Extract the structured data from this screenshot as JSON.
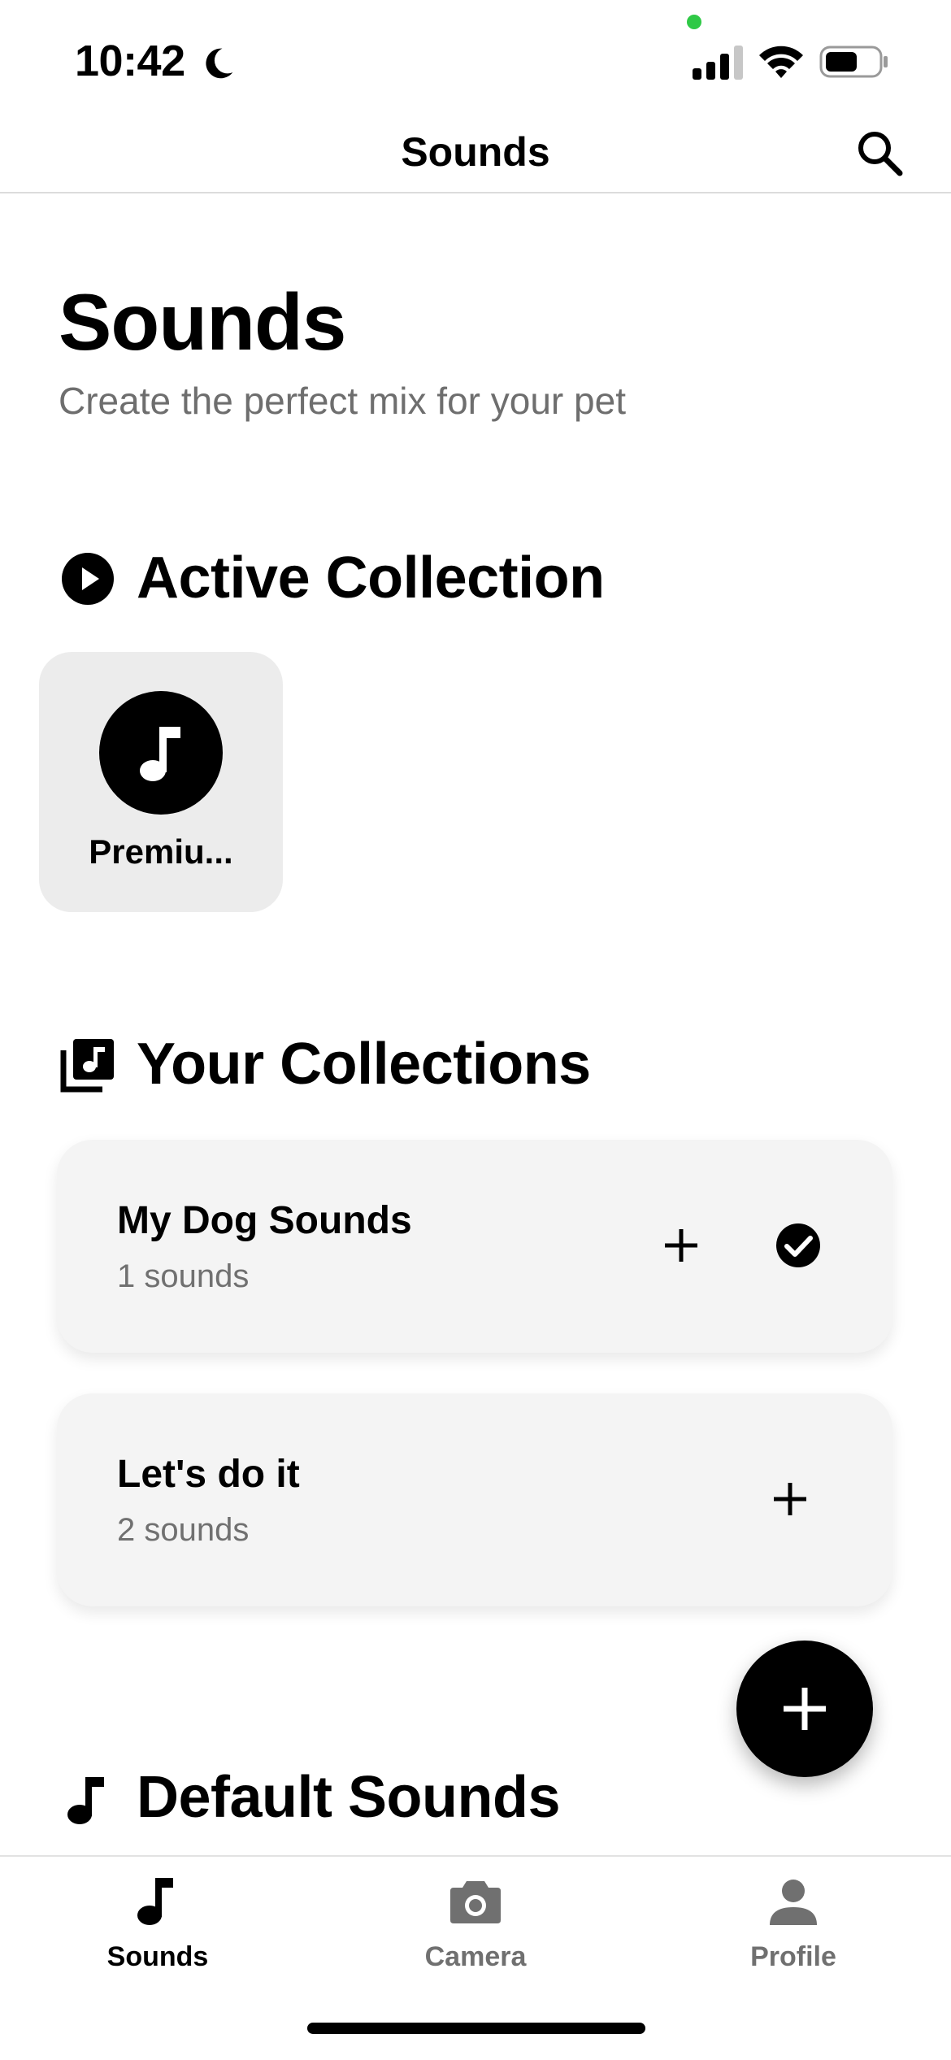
{
  "status_bar": {
    "time": "10:42"
  },
  "nav": {
    "title": "Sounds"
  },
  "header": {
    "title": "Sounds",
    "subtitle": "Create the perfect mix for your pet"
  },
  "sections": {
    "active": "Active Collection",
    "yours": "Your Collections",
    "default": "Default Sounds"
  },
  "active_collection": {
    "label": "Premiu..."
  },
  "collections": [
    {
      "name": "My Dog Sounds",
      "count": "1 sounds",
      "active": true
    },
    {
      "name": "Let's do it",
      "count": "2 sounds",
      "active": false
    }
  ],
  "tabs": [
    {
      "label": "Sounds",
      "icon": "music-note-icon",
      "selected": true
    },
    {
      "label": "Camera",
      "icon": "camera-icon",
      "selected": false
    },
    {
      "label": "Profile",
      "icon": "person-icon",
      "selected": false
    }
  ],
  "colors": {
    "accent": "#000000",
    "muted": "#6e6e6e",
    "card": "#f4f4f4",
    "recording_dot": "#2fc946",
    "tab_inactive": "#707070"
  }
}
